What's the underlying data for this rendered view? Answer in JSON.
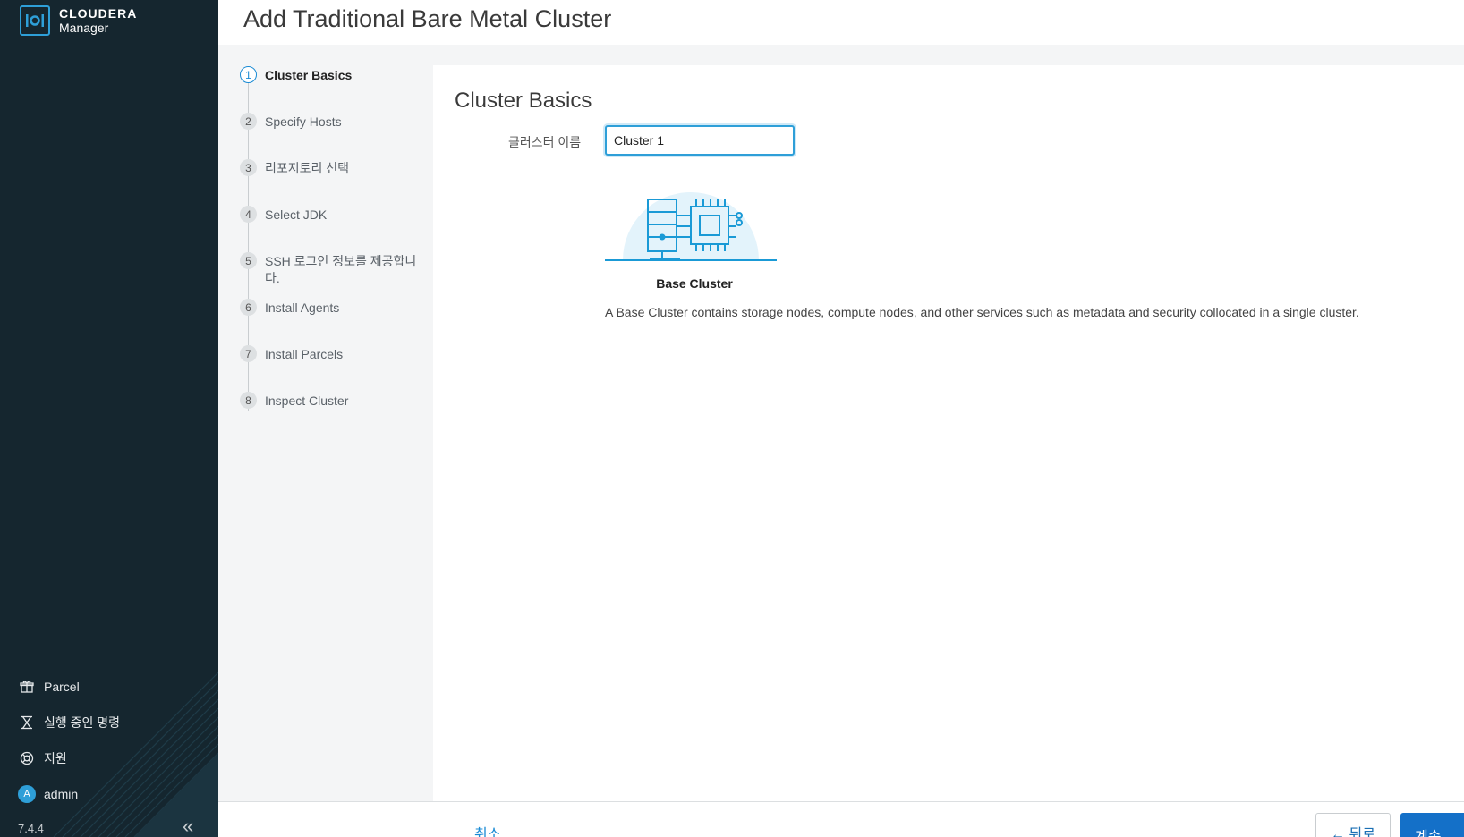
{
  "brand": {
    "name": "CLOUDERA",
    "product": "Manager"
  },
  "sidebar": {
    "items": [
      {
        "label": "Parcel",
        "icon": "gift-icon"
      },
      {
        "label": "실행 중인 명령",
        "icon": "hourglass-icon"
      },
      {
        "label": "지원",
        "icon": "lifebuoy-icon"
      },
      {
        "label": "admin",
        "icon": "avatar",
        "avatar_letter": "A"
      }
    ],
    "version": "7.4.4",
    "collapse_icon": "double-chevron-left-icon"
  },
  "header": {
    "title": "Add Traditional Bare Metal Cluster"
  },
  "steps": [
    {
      "num": "1",
      "label": "Cluster Basics",
      "active": true
    },
    {
      "num": "2",
      "label": "Specify Hosts"
    },
    {
      "num": "3",
      "label": "리포지토리 선택"
    },
    {
      "num": "4",
      "label": "Select JDK"
    },
    {
      "num": "5",
      "label": "SSH 로그인 정보를 제공합니다."
    },
    {
      "num": "6",
      "label": "Install Agents"
    },
    {
      "num": "7",
      "label": "Install Parcels"
    },
    {
      "num": "8",
      "label": "Inspect Cluster"
    }
  ],
  "main": {
    "title": "Cluster Basics",
    "cluster_name_label": "클러스터 이름",
    "cluster_name_value": "Cluster 1",
    "cluster_type": "Base Cluster",
    "cluster_description": "A Base Cluster contains storage nodes, compute nodes, and other services such as metadata and security collocated in a single cluster."
  },
  "footer": {
    "cancel_label": "취소",
    "back_label": "← 뒤로",
    "next_label": "계속 →"
  },
  "colors": {
    "sidebar_bg": "#15262f",
    "accent": "#2e9fd8",
    "primary_button": "#1470c8"
  }
}
